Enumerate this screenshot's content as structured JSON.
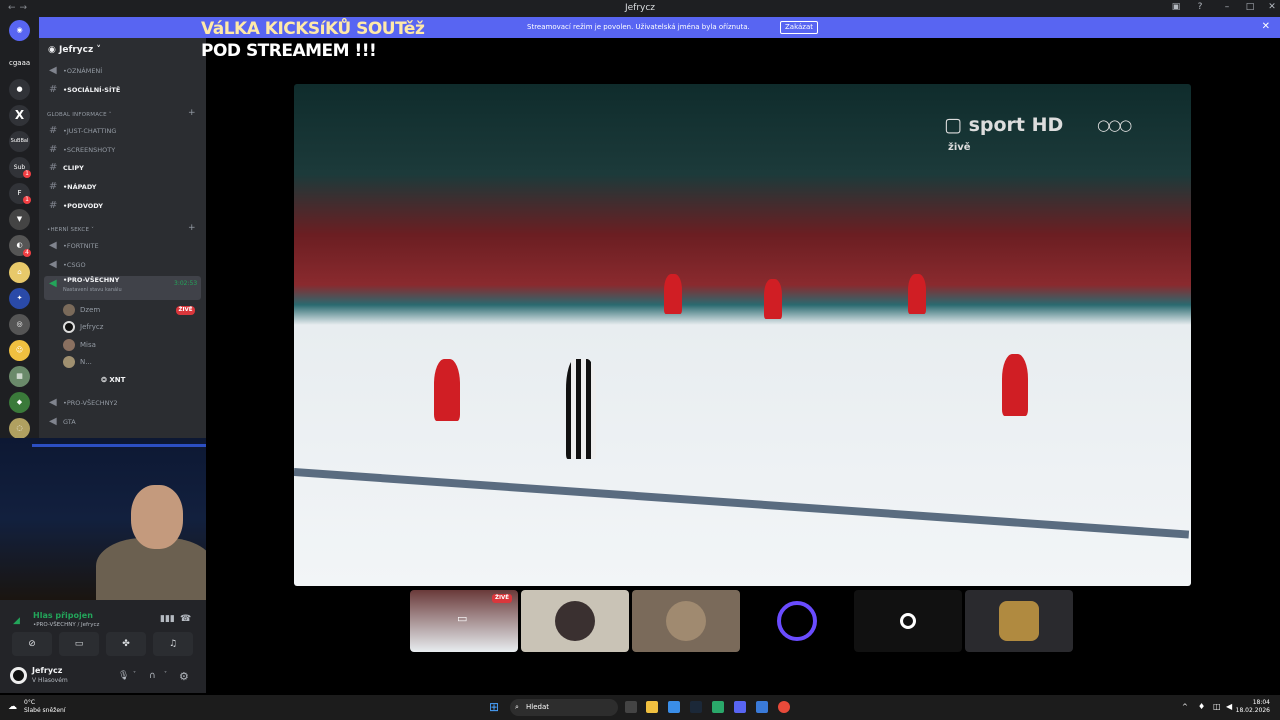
{
  "window": {
    "title": "Jefrycz"
  },
  "banner": {
    "text": "Streamovací režim je povolen. Uživatelská jména byla oříznuta.",
    "disable_label": "Zakázat"
  },
  "overlay": {
    "line1": "VáLKA KICKSíKŮ SOUTěž",
    "line2": "POD STREAMEM !!!"
  },
  "servers": [
    {
      "label": "cgaaa"
    },
    {
      "label": "X"
    },
    {
      "label": "SuBBal"
    },
    {
      "label": "Sub"
    },
    {
      "label": "F"
    }
  ],
  "guild": {
    "name": "Jefrycz"
  },
  "channels": {
    "ann": "•OZNÁMENÍ",
    "social": "•SOCIÁLNÍ-SÍTĚ",
    "cat_global": "GLOBAL INFORMACE",
    "just_chatting": "•JUST-CHATTING",
    "screens": "•SCREENSHOTY",
    "clips": "CLIPY",
    "ideas": "•NÁPADY",
    "scams": "•PODVODY",
    "cat_games": "•HERNÍ SEKCE",
    "fortnite": "•FORTNITE",
    "csgo": "•CSGO",
    "pro_all": "•PRO-VŠECHNY",
    "pro_all_status": "Nastavení stavu kanálu",
    "pro_all_time": "3:02:53",
    "users": [
      "Dzem",
      "Jefrycz",
      "Misa",
      "N..."
    ],
    "live_badge": "ŽIVĚ",
    "xnt": "XNT",
    "pro_all2": "•PRO-VŠECHNY2",
    "gta": "GTA"
  },
  "voice": {
    "status": "Hlas připojen",
    "channel": "•PRO-VŠECHNY / Jefrycz",
    "user_name": "Jefrycz",
    "user_status": "V Hlasovém"
  },
  "video": {
    "logo": "sport HD",
    "logo_sub": "živě",
    "live_badge": "ŽIVĚ"
  },
  "taskbar": {
    "temp": "0°C",
    "weather": "Slabé sněžení",
    "search": "Hledat",
    "time": "18:04",
    "date": "18.02.2026"
  }
}
